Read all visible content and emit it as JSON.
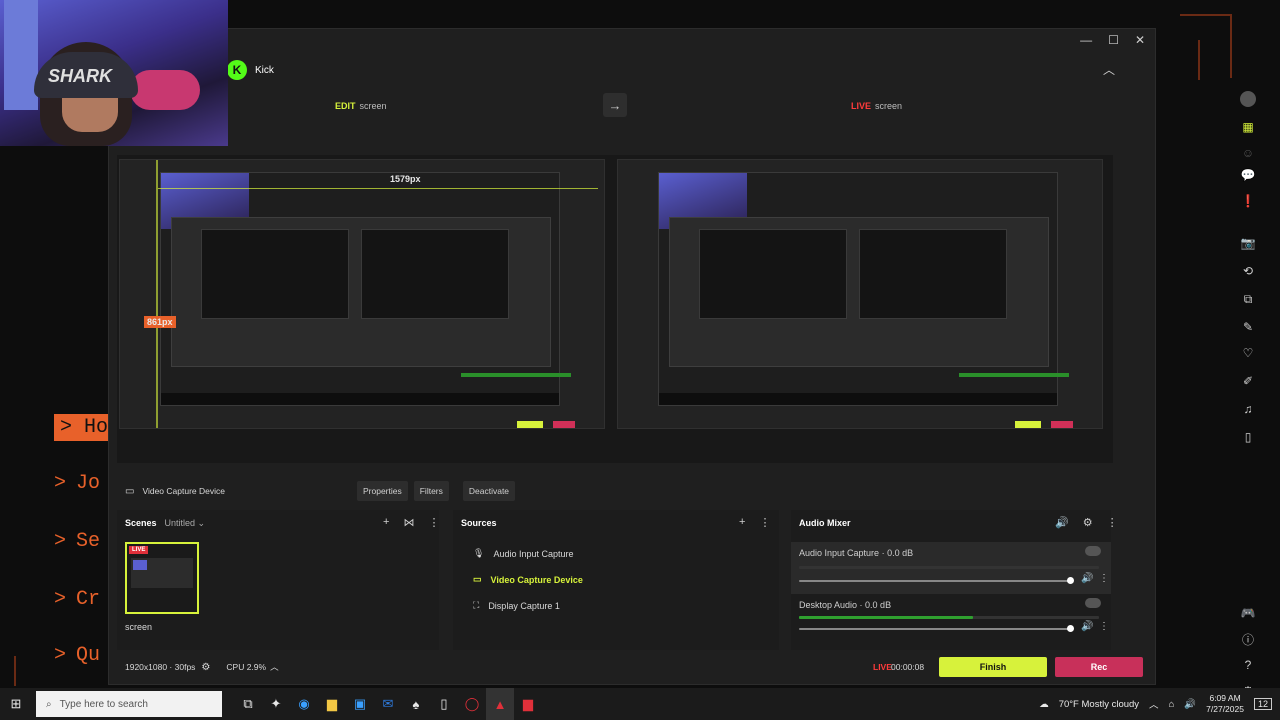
{
  "platform": {
    "name": "Kick",
    "logo_letter": "K"
  },
  "modes": {
    "edit_label": "EDIT",
    "edit_scene": "screen",
    "live_label": "LIVE",
    "live_scene": "screen"
  },
  "canvas": {
    "width_label": "1579px",
    "height_label": "861px"
  },
  "selected_source": {
    "name": "Video Capture Device",
    "buttons": [
      "Properties",
      "Filters",
      "Deactivate"
    ]
  },
  "scenes": {
    "title": "Scenes",
    "collection": "Untitled",
    "items": [
      {
        "name": "screen",
        "badge": "LIVE"
      }
    ]
  },
  "sources": {
    "title": "Sources",
    "items": [
      "Audio Input Capture",
      "Video Capture Device",
      "Display Capture 1"
    ]
  },
  "mixer": {
    "title": "Audio Mixer",
    "channels": [
      {
        "name": "Audio Input Capture",
        "level": "0.0 dB",
        "meter": 0.0
      },
      {
        "name": "Desktop Audio",
        "level": "0.0 dB",
        "meter": 0.58
      }
    ]
  },
  "status": {
    "resolution": "1920x1080 · 30fps",
    "cpu": "CPU 2.9%",
    "live_label": "LIVE",
    "timer": "00:00:08",
    "finish": "Finish",
    "rec": "Rec"
  },
  "terminal": {
    "lines": [
      "Ho",
      "Jo",
      "Se",
      "Cr",
      "Qu"
    ],
    "prompt": ">"
  },
  "taskbar": {
    "search_placeholder": "Type here to search",
    "weather": "70°F  Mostly cloudy",
    "time": "6:09 AM",
    "date": "7/27/2025",
    "notif_count": "12"
  },
  "colors": {
    "accent": "#d7f23b",
    "live": "#ff3b3b",
    "rec": "#c8305a",
    "kick": "#53fc18",
    "terminal": "#e8612a"
  },
  "icons": {
    "right_bar": [
      "avatar-icon",
      "layout-icon",
      "people-icon",
      "chat-icon",
      "alert-icon",
      "camera-icon",
      "replay-icon",
      "multistream-icon",
      "pen-icon",
      "heart-icon",
      "paint-icon",
      "music-icon",
      "phone-icon",
      "controller-icon",
      "info-icon",
      "help-icon",
      "settings-icon"
    ]
  }
}
